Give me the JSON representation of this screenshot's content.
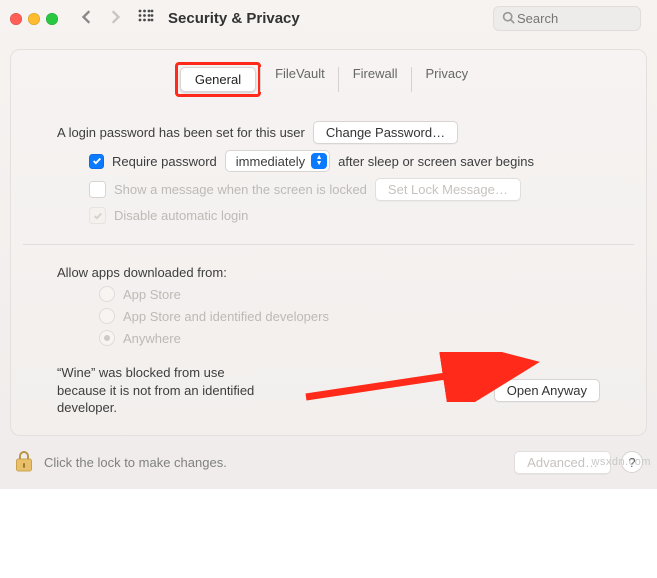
{
  "header": {
    "title": "Security & Privacy",
    "search_placeholder": "Search"
  },
  "tabs": {
    "general": "General",
    "filevault": "FileVault",
    "firewall": "Firewall",
    "privacy": "Privacy",
    "active": "general"
  },
  "password": {
    "login_set_text": "A login password has been set for this user",
    "change_button": "Change Password…",
    "require_label_pre": "Require password",
    "require_select": "immediately",
    "require_label_post": "after sleep or screen saver begins",
    "show_message_label": "Show a message when the screen is locked",
    "set_lock_button": "Set Lock Message…",
    "disable_auto_login": "Disable automatic login"
  },
  "downloads": {
    "heading": "Allow apps downloaded from:",
    "options": [
      {
        "label": "App Store",
        "selected": false
      },
      {
        "label": "App Store and identified developers",
        "selected": false
      },
      {
        "label": "Anywhere",
        "selected": true
      }
    ]
  },
  "blocked": {
    "message": "“Wine” was blocked from use because it is not from an identified developer.",
    "open_button": "Open Anyway"
  },
  "footer": {
    "lock_text": "Click the lock to make changes.",
    "advanced_button": "Advanced…",
    "help": "?"
  },
  "watermark": "wsxdn.com",
  "annotations": {
    "highlight": "General tab (red outline)",
    "arrow_target": "Open Anyway button"
  },
  "colors": {
    "accent": "#0a7aff",
    "annotation": "#ff2a1a"
  }
}
